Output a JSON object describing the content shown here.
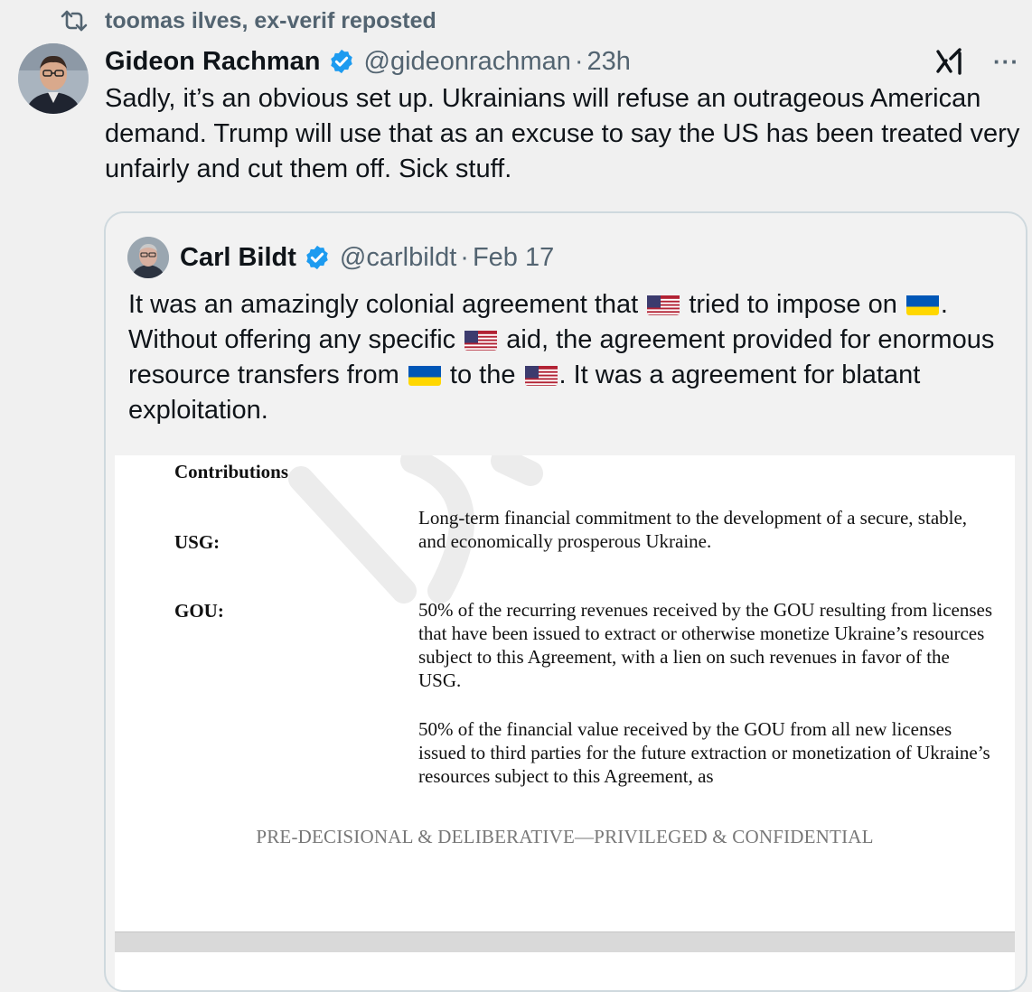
{
  "repost": {
    "icon": "repost-icon",
    "label": "toomas ilves, ex-verif reposted"
  },
  "tweet": {
    "avatar_icon": "user-avatar",
    "name": "Gideon Rachman",
    "verified_icon": "verified-badge-icon",
    "handle": "@gideonrachman",
    "separator": "·",
    "time": "23h",
    "grok_icon": "grok-icon",
    "more": "···",
    "text": "Sadly, it’s an obvious set up. Ukrainians will refuse an outrageous American demand. Trump will use that as an excuse to say the US has been treated very unfairly and cut them off. Sick stuff."
  },
  "quote": {
    "avatar_icon": "user-avatar",
    "name": "Carl Bildt",
    "verified_icon": "verified-badge-icon",
    "handle": "@carlbildt",
    "separator": "·",
    "time": "Feb 17",
    "text_parts": {
      "p1": "It was an amazingly colonial agreement that",
      "p2": "tried to impose on",
      "p3": ".",
      "p4": "Without offering any specific",
      "p5": "aid, the agreement provided for enormous resource transfers from",
      "p6": "to the",
      "p7": ". It was a agreement for blatant exploitation."
    },
    "flags": {
      "us": "us-flag-emoji",
      "ukraine": "ukraine-flag-emoji"
    }
  },
  "document": {
    "heading": "Contributions",
    "usg_label": "USG:",
    "usg_text": "Long-term financial commitment to the development of a secure, stable, and economically prosperous Ukraine.",
    "gou_label": "GOU:",
    "gou_text_1": "50% of the recurring revenues received by the GOU resulting from licenses that have been issued to extract or otherwise monetize Ukraine’s resources subject to this Agreement, with a lien on such revenues in favor of the USG.",
    "gou_text_2": "50% of the financial value received by the GOU from all new licenses issued to third parties for the future extraction or monetization of Ukraine’s resources subject to this Agreement, as",
    "footer": "PRE-DECISIONAL & DELIBERATIVE—PRIVILEGED & CONFIDENTIAL"
  },
  "colors": {
    "background": "#f0f0f0",
    "verified_blue": "#1d9bf0",
    "secondary_text": "#536471",
    "primary_text": "#0f1419"
  }
}
